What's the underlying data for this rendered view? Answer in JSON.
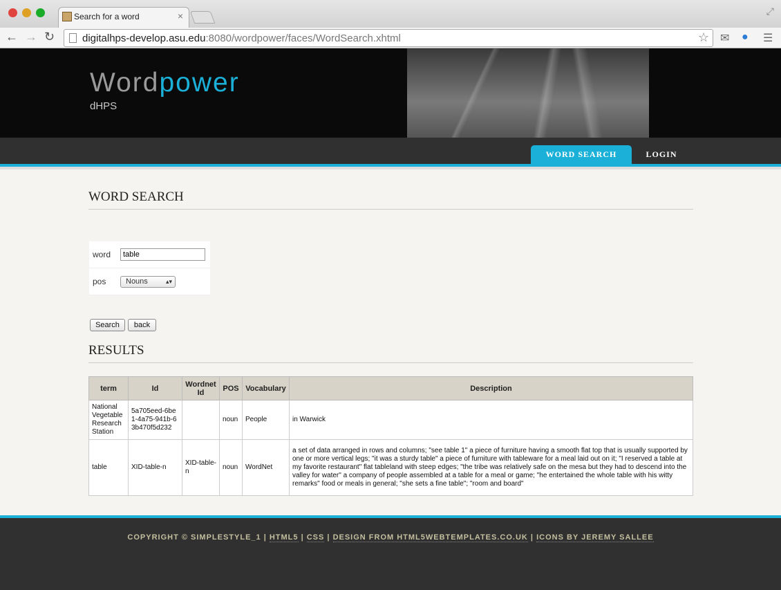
{
  "browser": {
    "tab_title": "Search for a word",
    "tab_close": "×",
    "url_host": "digitalhps-develop.asu.edu",
    "url_path": ":8080/wordpower/faces/WordSearch.xhtml",
    "icons": [
      "back-icon",
      "forward-icon",
      "reload-icon",
      "star-icon",
      "gmail-icon",
      "globe-icon",
      "menu-icon",
      "fullscreen-icon"
    ]
  },
  "header": {
    "logo_part1": "Word",
    "logo_part2": "power",
    "slogan": "dHPS",
    "accent_color": "#1ab0d8"
  },
  "menu": {
    "word_search": "WORD SEARCH",
    "login": "LOGIN"
  },
  "search": {
    "heading": "WORD SEARCH",
    "word_label": "word",
    "word_value": "table",
    "pos_label": "pos",
    "pos_selected": "Nouns",
    "search_button": "Search",
    "back_button": "back"
  },
  "results": {
    "heading": "RESULTS",
    "columns": [
      "term",
      "Id",
      "Wordnet Id",
      "POS",
      "Vocabulary",
      "Description"
    ],
    "rows": [
      {
        "term": "National Vegetable Research Station",
        "id": "5a705eed-6be1-4a75-941b-63b470f5d232",
        "wordnet_id": "",
        "pos": "noun",
        "vocabulary": "People",
        "description": "in Warwick"
      },
      {
        "term": "table",
        "id": "XID-table-n",
        "wordnet_id": "XID-table-n",
        "pos": "noun",
        "vocabulary": "WordNet",
        "description": "a set of data arranged in rows and columns; \"see table 1\" a piece of furniture having a smooth flat top that is usually supported by one or more vertical legs; \"it was a sturdy table\" a piece of furniture with tableware for a meal laid out on it; \"I reserved a table at my favorite restaurant\" flat tableland with steep edges; \"the tribe was relatively safe on the mesa but they had to descend into the valley for water\" a company of people assembled at a table for a meal or game; \"he entertained the whole table with his witty remarks\" food or meals in general; \"she sets a fine table\"; \"room and board\""
      }
    ]
  },
  "footer": {
    "copyright": "COPYRIGHT © SIMPLESTYLE_1",
    "sep": " | ",
    "html5": "HTML5",
    "css": "CSS",
    "design": "DESIGN FROM HTML5WEBTEMPLATES.CO.UK",
    "icons": "ICONS BY JEREMY SALLEE"
  }
}
